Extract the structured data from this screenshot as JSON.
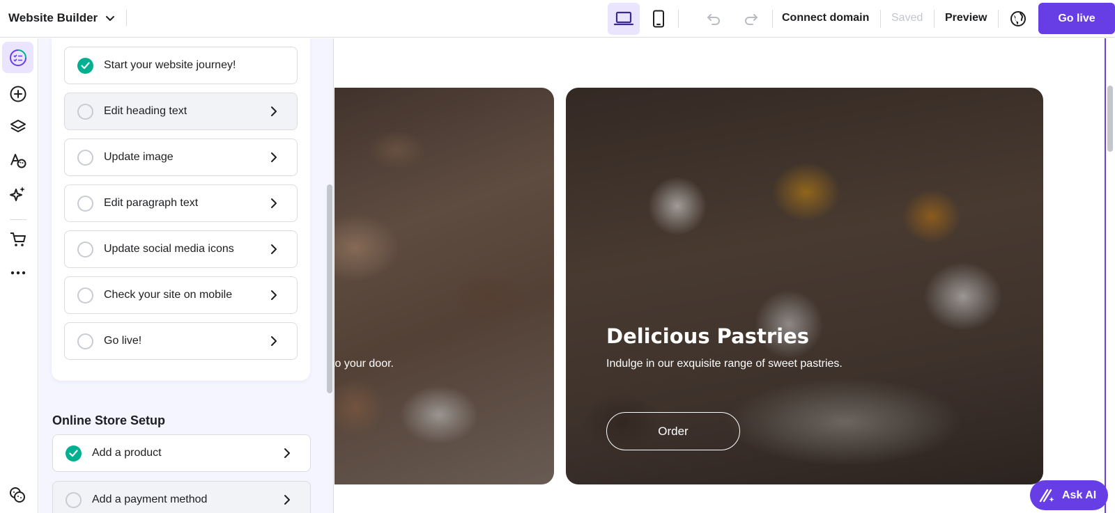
{
  "topbar": {
    "app_title": "Website Builder",
    "connect_domain": "Connect domain",
    "saved": "Saved",
    "preview": "Preview",
    "go_live": "Go live"
  },
  "rail": {
    "icons": [
      "checklist-icon",
      "add-icon",
      "layers-icon",
      "styles-icon",
      "ai-tools-icon",
      "store-cart-icon",
      "more-icon",
      "cookies-icon"
    ]
  },
  "checklist": {
    "tasks": [
      {
        "label": "Start your website journey!",
        "done": true
      },
      {
        "label": "Edit heading text",
        "done": false
      },
      {
        "label": "Update image",
        "done": false
      },
      {
        "label": "Edit paragraph text",
        "done": false
      },
      {
        "label": "Update social media icons",
        "done": false
      },
      {
        "label": "Check your site on mobile",
        "done": false
      },
      {
        "label": "Go live!",
        "done": false
      }
    ]
  },
  "store_setup": {
    "title": "Online Store Setup",
    "tasks": [
      {
        "label": "Add a product",
        "done": true
      },
      {
        "label": "Add a payment method",
        "done": false
      }
    ]
  },
  "canvas": {
    "slide_left_subtitle": "d to your door.",
    "slide_right_title": "Delicious Pastries",
    "slide_right_subtitle": "Indulge in our exquisite range of sweet pastries.",
    "order_button": "Order"
  },
  "ask_ai": "Ask AI",
  "colors": {
    "accent": "#673de6",
    "accent_light": "#ebe4ff",
    "success": "#00b090"
  }
}
